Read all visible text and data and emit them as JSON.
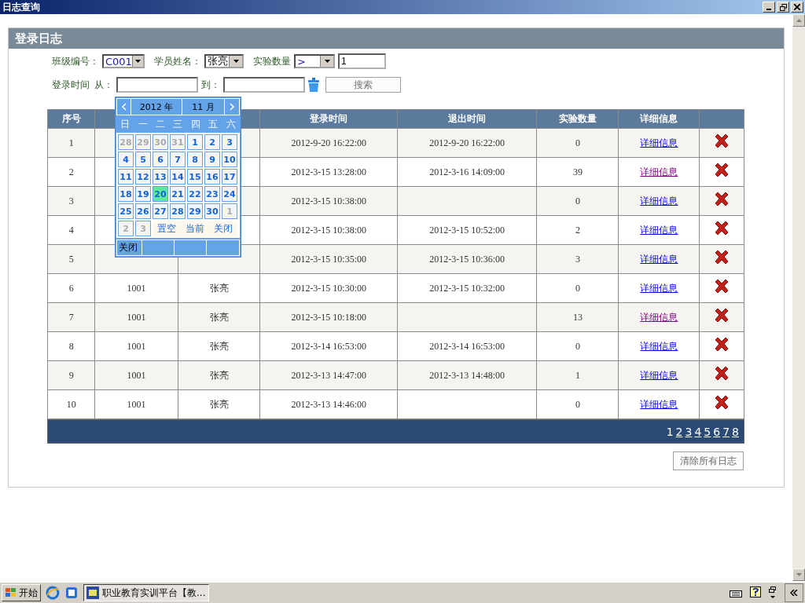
{
  "window": {
    "title": "日志查询"
  },
  "panel": {
    "title": "登录日志"
  },
  "filters": {
    "class_label": "班级编号：",
    "class_value": "C001",
    "student_label": "学员姓名：",
    "student_value": "张亮",
    "count_label": "实验数量",
    "count_op": ">",
    "count_value": "1",
    "time_label": "登录时间",
    "from_label": "从：",
    "to_label": "到：",
    "search_button": "搜索"
  },
  "calendar": {
    "year": "2012 年",
    "month": "11 月",
    "weekdays": [
      "日",
      "一",
      "二",
      "三",
      "四",
      "五",
      "六"
    ],
    "days": [
      {
        "label": "28",
        "kind": "other",
        "selected": false
      },
      {
        "label": "29",
        "kind": "other",
        "selected": false
      },
      {
        "label": "30",
        "kind": "other",
        "selected": false
      },
      {
        "label": "31",
        "kind": "other",
        "selected": false
      },
      {
        "label": "1",
        "kind": "day",
        "selected": false
      },
      {
        "label": "2",
        "kind": "day",
        "selected": false
      },
      {
        "label": "3",
        "kind": "day",
        "selected": false
      },
      {
        "label": "4",
        "kind": "day",
        "selected": false
      },
      {
        "label": "5",
        "kind": "day",
        "selected": false
      },
      {
        "label": "6",
        "kind": "day",
        "selected": false
      },
      {
        "label": "7",
        "kind": "day",
        "selected": false
      },
      {
        "label": "8",
        "kind": "day",
        "selected": false
      },
      {
        "label": "9",
        "kind": "day",
        "selected": false
      },
      {
        "label": "10",
        "kind": "day",
        "selected": false
      },
      {
        "label": "11",
        "kind": "day",
        "selected": false
      },
      {
        "label": "12",
        "kind": "day",
        "selected": false
      },
      {
        "label": "13",
        "kind": "day",
        "selected": false
      },
      {
        "label": "14",
        "kind": "day",
        "selected": false
      },
      {
        "label": "15",
        "kind": "day",
        "selected": false
      },
      {
        "label": "16",
        "kind": "day",
        "selected": false
      },
      {
        "label": "17",
        "kind": "day",
        "selected": false
      },
      {
        "label": "18",
        "kind": "day",
        "selected": false
      },
      {
        "label": "19",
        "kind": "day",
        "selected": false
      },
      {
        "label": "20",
        "kind": "day",
        "selected": true
      },
      {
        "label": "21",
        "kind": "day",
        "selected": false
      },
      {
        "label": "22",
        "kind": "day",
        "selected": false
      },
      {
        "label": "23",
        "kind": "day",
        "selected": false
      },
      {
        "label": "24",
        "kind": "day",
        "selected": false
      },
      {
        "label": "25",
        "kind": "day",
        "selected": false
      },
      {
        "label": "26",
        "kind": "day",
        "selected": false
      },
      {
        "label": "27",
        "kind": "day",
        "selected": false
      },
      {
        "label": "28",
        "kind": "day",
        "selected": false
      },
      {
        "label": "29",
        "kind": "day",
        "selected": false
      },
      {
        "label": "30",
        "kind": "day",
        "selected": false
      },
      {
        "label": "1",
        "kind": "other",
        "selected": false
      },
      {
        "label": "2",
        "kind": "other",
        "selected": false
      },
      {
        "label": "3",
        "kind": "other",
        "selected": false
      }
    ],
    "actions": [
      "置空",
      "当前",
      "关闭"
    ],
    "footer": "关闭"
  },
  "table": {
    "columns": [
      {
        "label": "序号"
      },
      {},
      {},
      {
        "label": "登录时间"
      },
      {
        "label": "退出时间"
      },
      {
        "label": "实验数量"
      },
      {
        "label": "详细信息"
      },
      {}
    ],
    "rows": [
      {
        "no": "1",
        "login": "2012-9-20 16:22:00",
        "logout": "2012-9-20 16:22:00",
        "count": "0",
        "detail": "详细信息",
        "visited": false
      },
      {
        "no": "2",
        "login": "2012-3-15 13:28:00",
        "logout": "2012-3-16 14:09:00",
        "count": "39",
        "detail": "详细信息",
        "visited": true
      },
      {
        "no": "3",
        "login": "2012-3-15 10:38:00",
        "count": "0",
        "detail": "详细信息",
        "visited": false
      },
      {
        "no": "4",
        "login": "2012-3-15 10:38:00",
        "logout": "2012-3-15 10:52:00",
        "count": "2",
        "detail": "详细信息",
        "visited": false
      },
      {
        "no": "5",
        "login": "2012-3-15 10:35:00",
        "logout": "2012-3-15 10:36:00",
        "count": "3",
        "detail": "详细信息",
        "visited": false
      },
      {
        "no": "6",
        "class_no": "1001",
        "name": "张亮",
        "login": "2012-3-15 10:30:00",
        "logout": "2012-3-15 10:32:00",
        "count": "0",
        "detail": "详细信息",
        "visited": false
      },
      {
        "no": "7",
        "class_no": "1001",
        "name": "张亮",
        "login": "2012-3-15 10:18:00",
        "count": "13",
        "detail": "详细信息",
        "visited": true
      },
      {
        "no": "8",
        "class_no": "1001",
        "name": "张亮",
        "login": "2012-3-14 16:53:00",
        "logout": "2012-3-14 16:53:00",
        "count": "0",
        "detail": "详细信息",
        "visited": false
      },
      {
        "no": "9",
        "class_no": "1001",
        "name": "张亮",
        "login": "2012-3-13 14:47:00",
        "logout": "2012-3-13 14:48:00",
        "count": "1",
        "detail": "详细信息",
        "visited": false
      },
      {
        "no": "10",
        "class_no": "1001",
        "name": "张亮",
        "login": "2012-3-13 14:46:00",
        "count": "0",
        "detail": "详细信息",
        "visited": false
      }
    ]
  },
  "pagination": {
    "pages": [
      {
        "label": "1",
        "selected": true
      },
      {
        "label": "2",
        "selected": false
      },
      {
        "label": "3",
        "selected": false
      },
      {
        "label": "4",
        "selected": false
      },
      {
        "label": "5",
        "selected": false
      },
      {
        "label": "6",
        "selected": false
      },
      {
        "label": "7",
        "selected": false
      },
      {
        "label": "8",
        "selected": false
      }
    ]
  },
  "clear_button": "清除所有日志",
  "taskbar": {
    "start": "开始",
    "task": "职业教育实训平台【教..."
  }
}
